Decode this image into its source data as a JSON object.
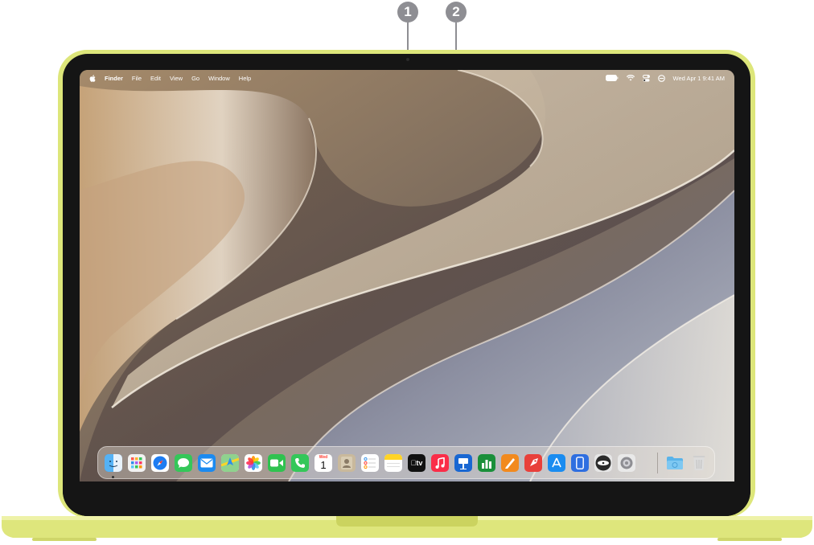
{
  "callouts": [
    {
      "number": "1"
    },
    {
      "number": "2"
    }
  ],
  "menubar": {
    "app_name": "Finder",
    "menus": [
      "File",
      "Edit",
      "View",
      "Go",
      "Window",
      "Help"
    ],
    "datetime": "Wed Apr 1  9:41 AM"
  },
  "dock": {
    "apps": [
      {
        "name": "finder-icon",
        "color": "#2f8fe8"
      },
      {
        "name": "launchpad-icon",
        "color": "#f2f2f2"
      },
      {
        "name": "safari-icon",
        "color": "#1d7cf2"
      },
      {
        "name": "messages-icon",
        "color": "#34c759"
      },
      {
        "name": "mail-icon",
        "color": "#1b8af0"
      },
      {
        "name": "maps-icon",
        "color": "#5bbf6a"
      },
      {
        "name": "photos-icon",
        "color": "#ffffff"
      },
      {
        "name": "facetime-icon",
        "color": "#2fc24f"
      },
      {
        "name": "phone-icon",
        "color": "#34c759"
      },
      {
        "name": "calendar-icon",
        "color": "#ffffff"
      },
      {
        "name": "contacts-icon",
        "color": "#c9b99c"
      },
      {
        "name": "reminders-icon",
        "color": "#ffffff"
      },
      {
        "name": "notes-icon",
        "color": "#ffd426"
      },
      {
        "name": "tv-icon",
        "color": "#111111"
      },
      {
        "name": "music-icon",
        "color": "#fa2d48"
      },
      {
        "name": "keynote-icon",
        "color": "#1967d2"
      },
      {
        "name": "numbers-icon",
        "color": "#1a8f3a"
      },
      {
        "name": "pages-icon",
        "color": "#f28a1e"
      },
      {
        "name": "testflight-icon",
        "color": "#e8403a"
      },
      {
        "name": "app-store-icon",
        "color": "#1a8cf0"
      },
      {
        "name": "iphone-mirroring-icon",
        "color": "#2f6fe0"
      },
      {
        "name": "disk-utility-icon",
        "color": "#3a3a3a"
      },
      {
        "name": "system-settings-icon",
        "color": "#9a9a9a"
      }
    ],
    "calendar": {
      "month": "Wed",
      "day": "1"
    },
    "tv_label": "tv",
    "downloads_folder": {
      "name": "downloads-folder-icon",
      "color": "#5ab4ea"
    },
    "trash": {
      "name": "trash-icon",
      "color": "#d9d9d9"
    }
  }
}
